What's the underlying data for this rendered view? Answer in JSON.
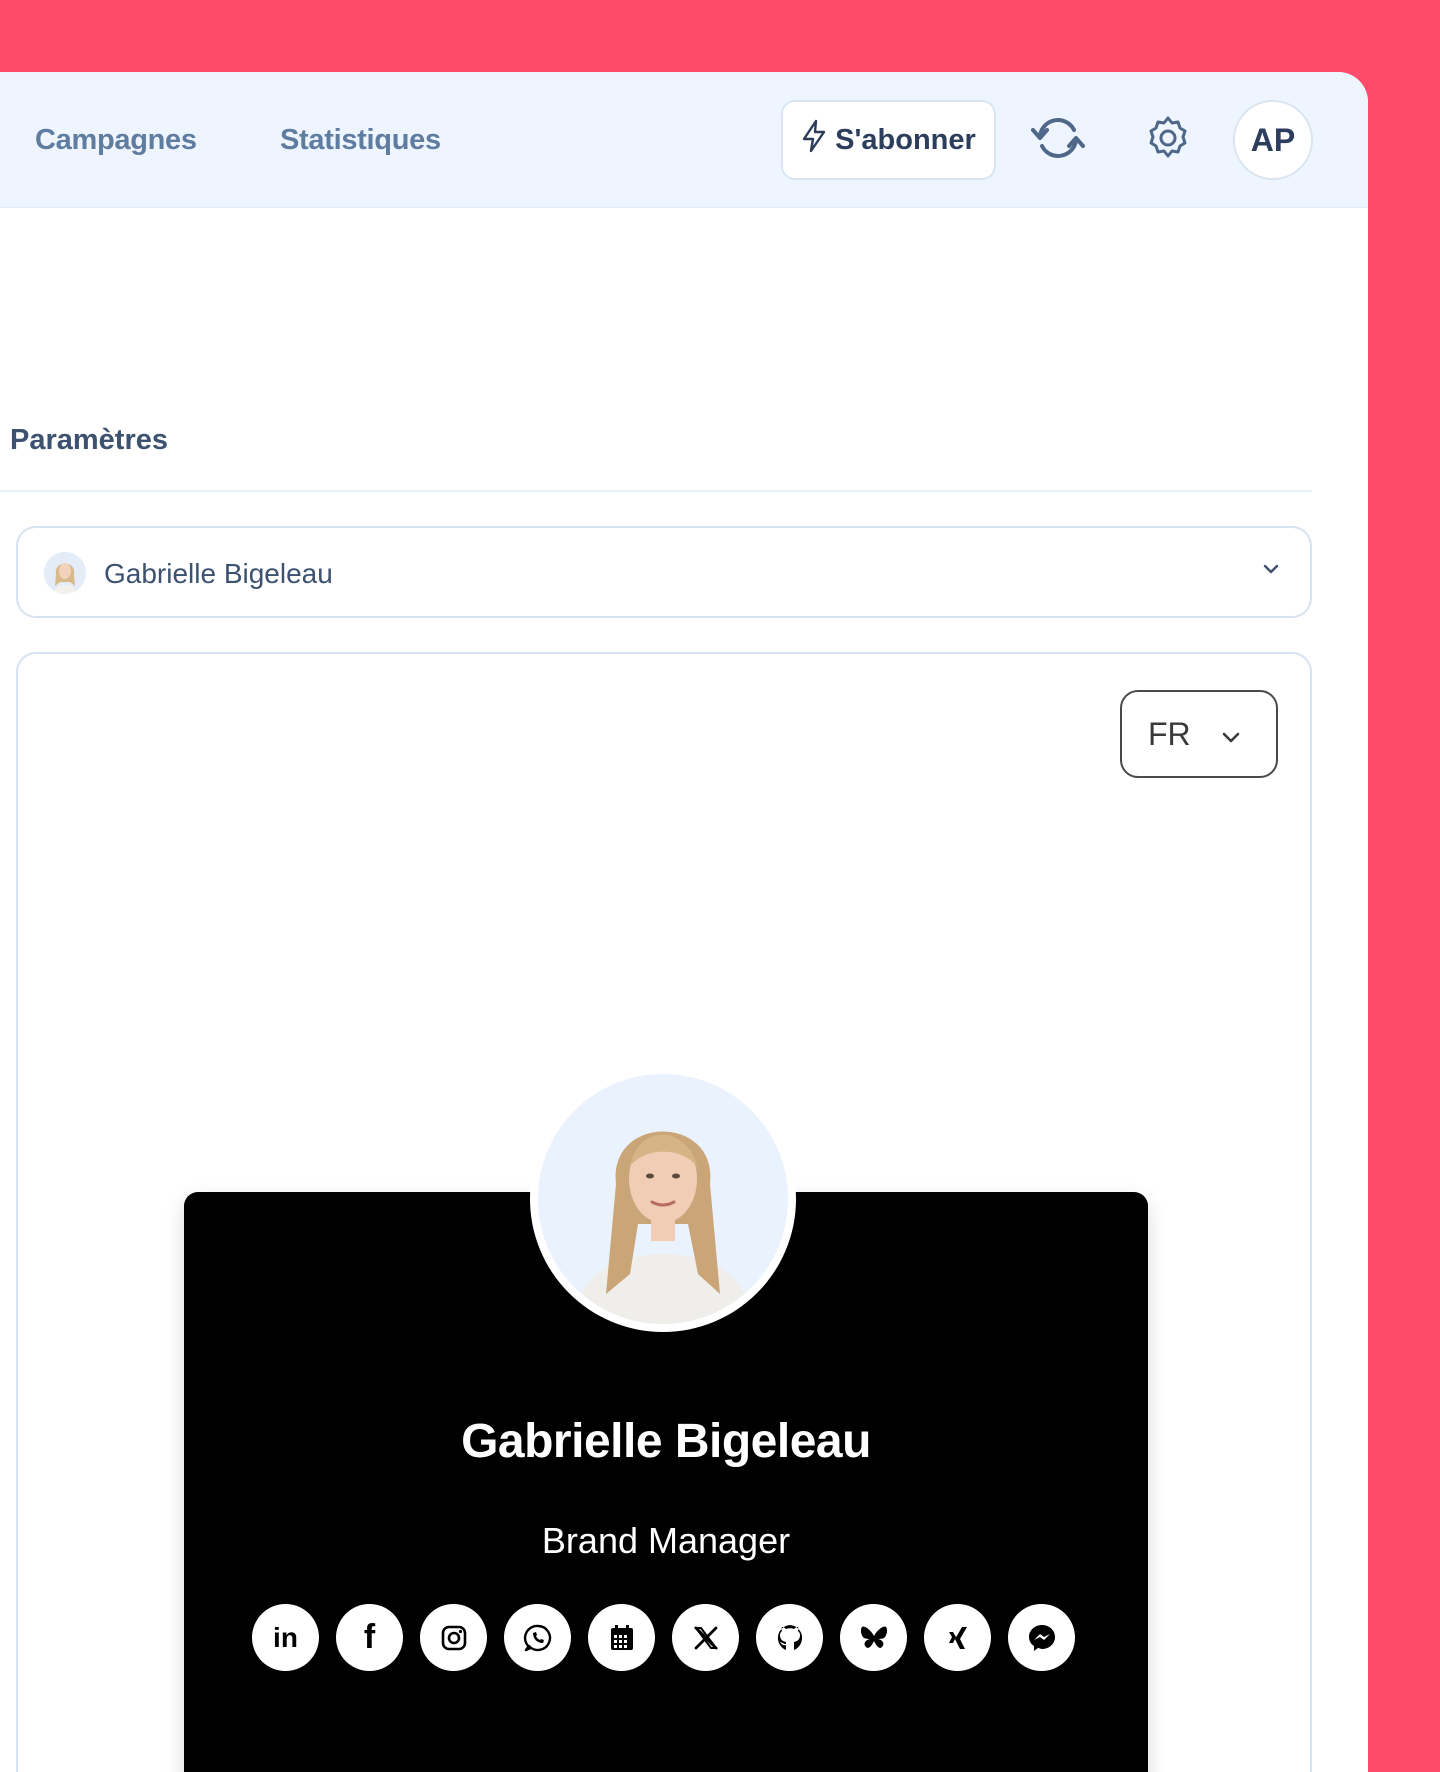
{
  "nav": {
    "campaigns_label": "Campagnes",
    "stats_label": "Statistiques"
  },
  "header": {
    "subscribe_label": "S'abonner",
    "avatar_initials": "AP"
  },
  "settings": {
    "section_title": "Paramètres",
    "selected_profile": "Gabrielle Bigeleau"
  },
  "preview": {
    "language": "FR",
    "card": {
      "name": "Gabrielle Bigeleau",
      "role": "Brand Manager"
    },
    "socials": [
      {
        "icon": "linkedin-icon",
        "glyph": "in"
      },
      {
        "icon": "facebook-icon",
        "glyph": "f"
      },
      {
        "icon": "instagram-icon"
      },
      {
        "icon": "whatsapp-icon"
      },
      {
        "icon": "calendar-icon"
      },
      {
        "icon": "x-twitter-icon",
        "glyph": "𝕏"
      },
      {
        "icon": "github-icon"
      },
      {
        "icon": "bluesky-icon"
      },
      {
        "icon": "xing-icon"
      },
      {
        "icon": "messenger-icon"
      }
    ]
  },
  "colors": {
    "background": "#ff4c6c",
    "topbar": "#eef5fe",
    "nav_text": "#5f7ca1",
    "dark_text": "#2c3e5c",
    "card_bg": "#000000"
  }
}
